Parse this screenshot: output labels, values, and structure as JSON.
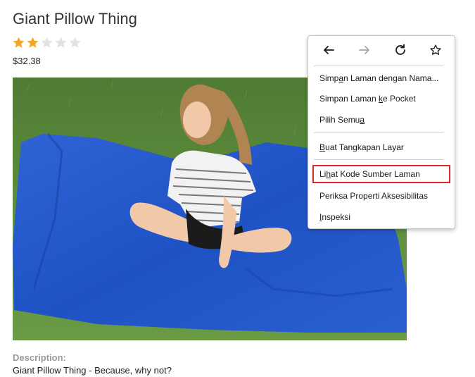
{
  "product": {
    "title": "Giant Pillow Thing",
    "rating": 2,
    "rating_max": 5,
    "price": "$32.38",
    "description_label": "Description:",
    "description": "Giant Pillow Thing - Because, why not?"
  },
  "colors": {
    "star_filled": "#f5a623",
    "star_empty": "#e2e2e2",
    "highlight_border": "#d9262e"
  },
  "context_menu": {
    "nav": [
      {
        "name": "back-icon",
        "enabled": true
      },
      {
        "name": "forward-icon",
        "enabled": false
      },
      {
        "name": "reload-icon",
        "enabled": true
      },
      {
        "name": "bookmark-star-icon",
        "enabled": true
      }
    ],
    "items": [
      {
        "pre": "Simp",
        "key": "a",
        "post": "n Laman dengan Nama..."
      },
      {
        "pre": "Simpan Laman ",
        "key": "k",
        "post": "e Pocket"
      },
      {
        "pre": "Pilih Semu",
        "key": "a",
        "post": ""
      },
      {
        "pre": "",
        "key": "B",
        "post": "uat Tangkapan Layar"
      },
      {
        "pre": "Li",
        "key": "h",
        "post": "at Kode Sumber Laman"
      },
      {
        "pre": "Periksa Properti Aksesibilitas",
        "key": "",
        "post": ""
      },
      {
        "pre": "",
        "key": "I",
        "post": "nspeksi"
      }
    ]
  }
}
